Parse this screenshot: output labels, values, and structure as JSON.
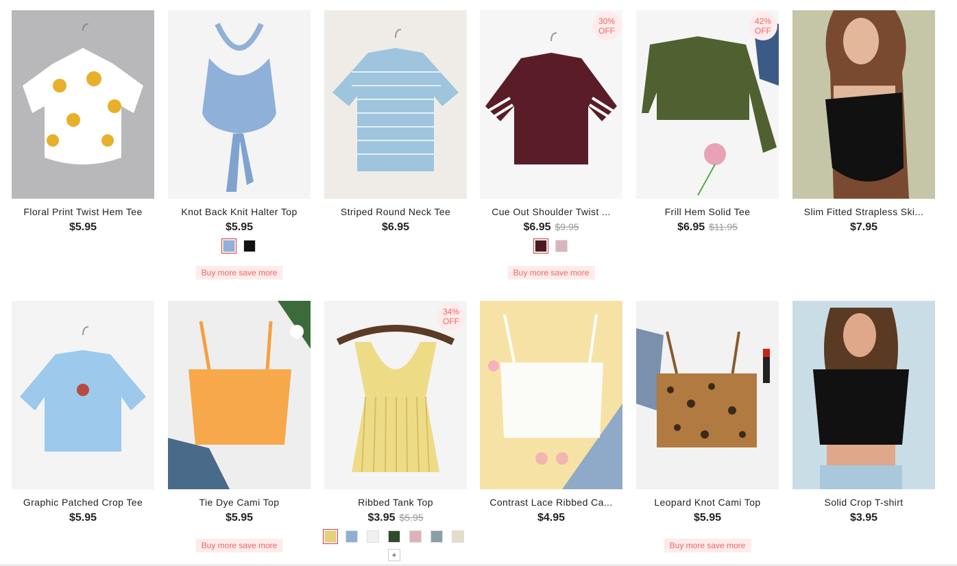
{
  "products": [
    {
      "title": "Floral Print Twist Hem Tee",
      "price": "$5.95",
      "old_price": "",
      "badge_pct": "",
      "badge_off": "",
      "promo": "",
      "swatches": []
    },
    {
      "title": "Knot Back Knit Halter Top",
      "price": "$5.95",
      "old_price": "",
      "badge_pct": "",
      "badge_off": "",
      "promo": "Buy more save more",
      "swatches": [
        "#8fb0d8",
        "#111111"
      ]
    },
    {
      "title": "Striped Round Neck Tee",
      "price": "$6.95",
      "old_price": "",
      "badge_pct": "",
      "badge_off": "",
      "promo": "",
      "swatches": []
    },
    {
      "title": "Cue Out Shoulder Twist ...",
      "price": "$6.95",
      "old_price": "$9.95",
      "badge_pct": "30%",
      "badge_off": "OFF",
      "promo": "Buy more save more",
      "swatches": [
        "#4a1a22",
        "#d8b5bd"
      ]
    },
    {
      "title": "Frill Hem Solid Tee",
      "price": "$6.95",
      "old_price": "$11.95",
      "badge_pct": "42%",
      "badge_off": "OFF",
      "promo": "",
      "swatches": []
    },
    {
      "title": "Slim Fitted Strapless Ski...",
      "price": "$7.95",
      "old_price": "",
      "badge_pct": "",
      "badge_off": "",
      "promo": "",
      "swatches": []
    },
    {
      "title": "Graphic Patched Crop Tee",
      "price": "$5.95",
      "old_price": "",
      "badge_pct": "",
      "badge_off": "",
      "promo": "",
      "swatches": []
    },
    {
      "title": "Tie Dye Cami Top",
      "price": "$5.95",
      "old_price": "",
      "badge_pct": "",
      "badge_off": "",
      "promo": "Buy more save more",
      "swatches": []
    },
    {
      "title": "Ribbed Tank Top",
      "price": "$3.95",
      "old_price": "$5.95",
      "badge_pct": "34%",
      "badge_off": "OFF",
      "promo": "",
      "swatches": [
        "#e8cf7a",
        "#8eaed4",
        "#f0f0f0",
        "#2f4a2c",
        "#e0b0b8",
        "#8a9ea6",
        "#e6dccb"
      ],
      "more": "+"
    },
    {
      "title": "Contrast Lace Ribbed Ca...",
      "price": "$4.95",
      "old_price": "",
      "badge_pct": "",
      "badge_off": "",
      "promo": "",
      "swatches": []
    },
    {
      "title": "Leopard Knot Cami Top",
      "price": "$5.95",
      "old_price": "",
      "badge_pct": "",
      "badge_off": "",
      "promo": "Buy more save more",
      "swatches": []
    },
    {
      "title": "Solid Crop T-shirt",
      "price": "$3.95",
      "old_price": "",
      "badge_pct": "",
      "badge_off": "",
      "promo": "",
      "swatches": []
    }
  ],
  "image_labels": [
    "floral-tee-image",
    "halter-top-image",
    "striped-tee-image",
    "cutout-tee-image",
    "frill-tee-image",
    "strapless-bodysuit-image",
    "graphic-tee-image",
    "tie-dye-cami-image",
    "ribbed-tank-image",
    "lace-cami-image",
    "leopard-cami-image",
    "crop-tshirt-image"
  ]
}
